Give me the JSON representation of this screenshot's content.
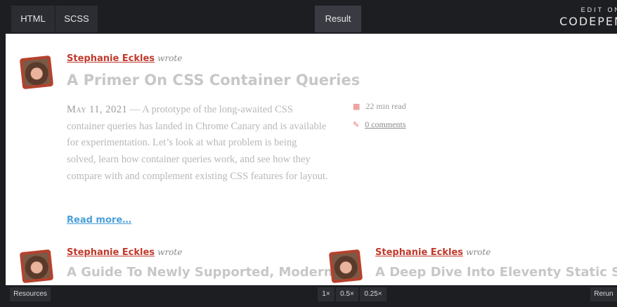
{
  "editor_tabs": {
    "html": "HTML",
    "scss": "SCSS",
    "result": "Result"
  },
  "logo": {
    "edit_on": "EDIT ON",
    "brand": "CODEPEN"
  },
  "posts": [
    {
      "author": "Stephanie Eckles",
      "wrote": "wrote",
      "title": "A Primer On CSS Container Queries",
      "date": "May 11, 2021",
      "separator": "—",
      "excerpt": "A prototype of the long-awaited CSS container queries has landed in Chrome Canary and is available for experimentation. Let’s look at what problem is being solved, learn how container queries work, and see how they compare with and complement existing CSS features for layout.",
      "read_time": "22 min read",
      "comments": "0 comments",
      "read_more": "Read more…"
    },
    {
      "author": "Stephanie Eckles",
      "wrote": "wrote",
      "title": "A Guide To Newly Supported, Modern"
    },
    {
      "author": "Stephanie Eckles",
      "wrote": "wrote",
      "title": "A Deep Dive Into Eleventy Static Site"
    }
  ],
  "bottom_bar": {
    "resources": "Resources",
    "zoom_1": "1×",
    "zoom_05": "0.5×",
    "zoom_025": "0.25×",
    "rerun": "Rerun"
  },
  "colors": {
    "author": "#c0392b",
    "title": "#c7c7c7",
    "link": "#4a9fd8",
    "avatar_frame": "#b5412d"
  },
  "icons": {
    "read_time": "calendar-icon",
    "comments": "comment-icon"
  }
}
